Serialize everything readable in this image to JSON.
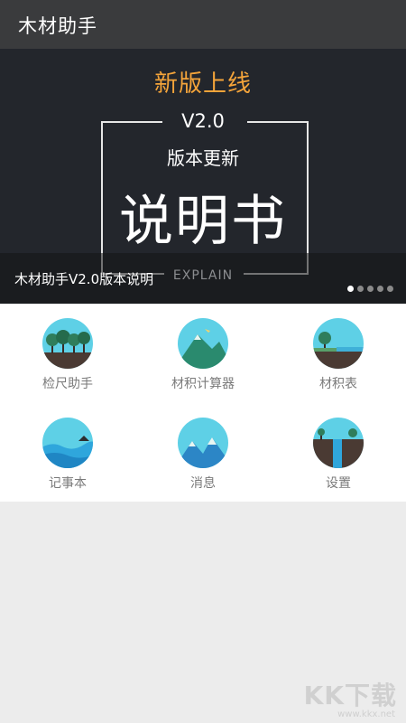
{
  "app": {
    "title": "木材助手"
  },
  "banner": {
    "headline": "新版上线",
    "version": "V2.0",
    "subtitle": "版本更新",
    "big_title": "说明书",
    "explain": "EXPLAIN",
    "caption": "木材助手V2.0版本说明",
    "slides": {
      "count": 5,
      "active_index": 0
    }
  },
  "menu": {
    "items": [
      {
        "label": "检尺助手",
        "icon": "forest-icon"
      },
      {
        "label": "材积计算器",
        "icon": "mountain-icon"
      },
      {
        "label": "材积表",
        "icon": "island-tree-icon"
      },
      {
        "label": "记事本",
        "icon": "sea-waves-icon"
      },
      {
        "label": "消息",
        "icon": "snow-mountain-icon"
      },
      {
        "label": "设置",
        "icon": "waterfall-icon"
      }
    ]
  },
  "watermark": {
    "logo": "KK下载",
    "url": "www.kkx.net"
  },
  "colors": {
    "accent": "#f4a43a",
    "topbar": "#3a3b3d",
    "banner": "#23262c",
    "icon_sky": "#5ed0e6"
  }
}
